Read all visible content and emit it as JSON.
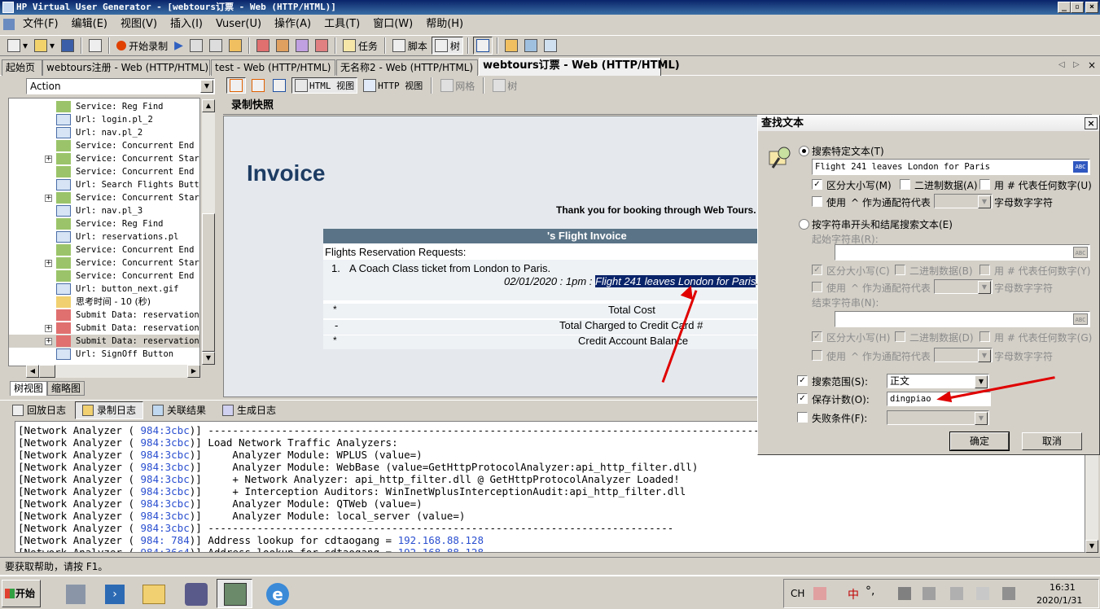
{
  "window": {
    "title": "HP Virtual User Generator - [webtours订票 - Web (HTTP/HTML)]"
  },
  "menu": [
    "文件(F)",
    "编辑(E)",
    "视图(V)",
    "插入(I)",
    "Vuser(U)",
    "操作(A)",
    "工具(T)",
    "窗口(W)",
    "帮助(H)"
  ],
  "toolbar": {
    "record": "开始录制",
    "task": "任务",
    "script": "脚本",
    "tree": "树"
  },
  "tabs": [
    "起始页",
    "webtours注册 - Web (HTTP/HTML)",
    "test - Web (HTTP/HTML)",
    "无名称2 - Web (HTTP/HTML)",
    "webtours订票 - Web (HTTP/HTML)"
  ],
  "left": {
    "action": "Action",
    "tree": [
      "Service: Reg Find",
      "Url: login.pl_2",
      "Url: nav.pl_2",
      "Service: Concurrent End",
      "Service: Concurrent Start",
      "Service: Concurrent End",
      "Url: Search Flights Button",
      "Service: Concurrent Start",
      "Url: nav.pl_3",
      "Service: Reg Find",
      "Url: reservations.pl",
      "Service: Concurrent End",
      "Service: Concurrent Start",
      "Service: Concurrent End",
      "Url: button_next.gif",
      "思考时间 - 10 (秒)",
      "Submit Data: reservations.",
      "Submit Data: reservations.",
      "Submit Data: reservations.",
      "Url: SignOff Button"
    ],
    "tabs": [
      "树视图",
      "缩略图"
    ]
  },
  "viewbar": {
    "html": "HTML 视图",
    "http": "HTTP 视图",
    "grid": "网格",
    "tree": "树"
  },
  "snapshot": {
    "header": "录制快照",
    "title": "Invoice",
    "thanks": "Thank you for booking through Web Tours.",
    "table_title": "'s Flight Invoice",
    "requests": "Flights Reservation Requests:",
    "item_num": "1.",
    "item": "A Coach Class ticket from London to Paris.",
    "date": "02/01/2020 : 1pm : ",
    "flight": "Flight 241 leaves London for Paris",
    "flight_end": ".",
    "total_cost": "Total Cost",
    "charged": "Total Charged to Credit Card #",
    "balance": "Credit Account Balance",
    "m1": "*",
    "m2": "-",
    "m3": "*"
  },
  "dialog": {
    "title": "查找文本",
    "opt1": "搜索特定文本(T)",
    "search_text": "Flight 241 leaves London  for Paris",
    "match_case": "区分大小写(M)",
    "binary": "二进制数据(A)",
    "hash": "用 # 代表任何数字(U)",
    "use": "使用",
    "wildcard": "^ 作为通配符代表",
    "alnum": "字母数字字符",
    "opt2": "按字符串开头和结尾搜索文本(E)",
    "start_label": "起始字符串(R):",
    "match_case2": "区分大小写(C)",
    "binary2": "二进制数据(B)",
    "hash2": "用 # 代表任何数字(Y)",
    "use2": "使用",
    "wildcard2": "^ 作为通配符代表",
    "alnum2": "字母数字字符",
    "end_label": "结束字符串(N):",
    "match_case3": "区分大小写(H)",
    "binary3": "二进制数据(D)",
    "hash3": "用 # 代表任何数字(G)",
    "use3": "使用",
    "wildcard3": "^ 作为通配符代表",
    "alnum3": "字母数字字符",
    "scope_label": "搜索范围(S):",
    "scope_value": "正文",
    "save_label": "保存计数(O):",
    "save_value": "dingpiao",
    "fail_label": "失败条件(F):",
    "ok": "确定",
    "cancel": "取消",
    "abc": "ABC"
  },
  "logtabs": [
    "回放日志",
    "录制日志",
    "关联结果",
    "生成日志"
  ],
  "log": [
    {
      "p": "[Network Analyzer ( ",
      "id": "984:3cbc",
      "m": ")] ",
      "t": "-------------------------------------------------------------------------------------------------"
    },
    {
      "p": "[Network Analyzer ( ",
      "id": "984:3cbc",
      "m": ")] ",
      "t": "Load Network Traffic Analyzers:"
    },
    {
      "p": "[Network Analyzer ( ",
      "id": "984:3cbc",
      "m": ")] ",
      "t": "    Analyzer Module: WPLUS (value=)"
    },
    {
      "p": "[Network Analyzer ( ",
      "id": "984:3cbc",
      "m": ")] ",
      "t": "    Analyzer Module: WebBase (value=GetHttpProtocolAnalyzer:api_http_filter.dll)"
    },
    {
      "p": "[Network Analyzer ( ",
      "id": "984:3cbc",
      "m": ")] ",
      "t": "    + Network Analyzer: api_http_filter.dll @ GetHttpProtocolAnalyzer Loaded!"
    },
    {
      "p": "[Network Analyzer ( ",
      "id": "984:3cbc",
      "m": ")] ",
      "t": "    + Interception Auditors: WinInetWplusInterceptionAudit:api_http_filter.dll"
    },
    {
      "p": "[Network Analyzer ( ",
      "id": "984:3cbc",
      "m": ")] ",
      "t": "    Analyzer Module: QTWeb (value=)"
    },
    {
      "p": "[Network Analyzer ( ",
      "id": "984:3cbc",
      "m": ")] ",
      "t": "    Analyzer Module: local_server (value=)"
    },
    {
      "p": "[Network Analyzer ( ",
      "id": "984:3cbc",
      "m": ")] ",
      "t": "----------------------------------------------------------------------------"
    },
    {
      "p": "[Network Analyzer ( ",
      "id": "984: 784",
      "m": ")] ",
      "t": "Address lookup for cdtaogang = ",
      "ip": "192.168.88.128"
    },
    {
      "p": "[Network Analyzer ( ",
      "id": "984:36c4",
      "m": ")] ",
      "t": "Address lookup for cdtaogang = ",
      "ip": "192.168.88.128"
    }
  ],
  "status": "要获取帮助，请按 F1。",
  "taskbar": {
    "start": "开始",
    "time": "16:31",
    "date": "2020/1/31",
    "ime1": "CH",
    "ime2": "中"
  },
  "colors": {
    "title": "#0a246a",
    "highlight": "#0a246a",
    "invoice_header": "#5a7386",
    "arrow": "#e00000",
    "link_blue": "#2a4fd0"
  }
}
